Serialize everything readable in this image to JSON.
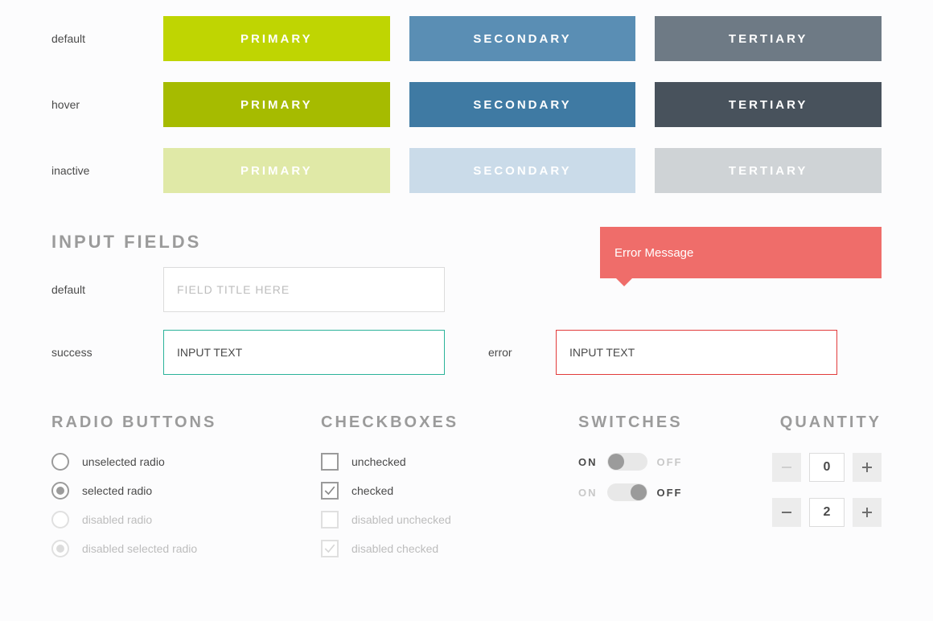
{
  "buttons": {
    "rows": [
      "default",
      "hover",
      "inactive"
    ],
    "labels": {
      "primary": "PRIMARY",
      "secondary": "SECONDARY",
      "tertiary": "TERTIARY"
    }
  },
  "sections": {
    "input_fields": "INPUT FIELDS",
    "radio_buttons": "RADIO BUTTONS",
    "checkboxes": "CHECKBOXES",
    "switches": "SWITCHES",
    "quantity": "QUANTITY"
  },
  "inputs": {
    "default_label": "default",
    "default_placeholder": "FIELD TITLE HERE",
    "success_label": "success",
    "success_value": "INPUT TEXT",
    "error_label": "error",
    "error_value": "INPUT TEXT",
    "error_message": "Error Message"
  },
  "radios": {
    "unselected": "unselected radio",
    "selected": "selected radio",
    "disabled": "disabled radio",
    "disabled_selected": "disabled selected radio"
  },
  "checkboxes": {
    "unchecked": "unchecked",
    "checked": "checked",
    "disabled_unchecked": "disabled unchecked",
    "disabled_checked": "disabled checked"
  },
  "switches": {
    "on": "ON",
    "off": "OFF"
  },
  "quantity": {
    "value1": "0",
    "value2": "2"
  }
}
